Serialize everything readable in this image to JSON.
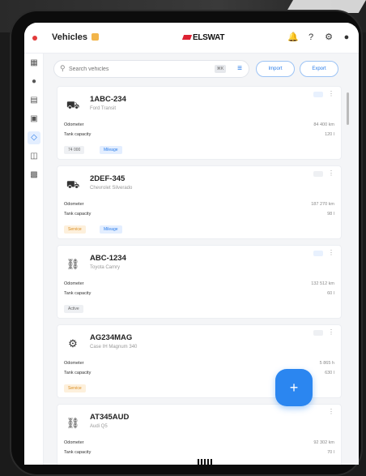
{
  "app": {
    "title": "Vehicles",
    "logo": "ELSWAT"
  },
  "header_icons": [
    "bell-icon",
    "help-icon",
    "settings-icon",
    "account-icon"
  ],
  "sidebar": {
    "items": [
      {
        "icon": "dashboard-icon",
        "active": false
      },
      {
        "icon": "user-icon",
        "active": false
      },
      {
        "icon": "document-icon",
        "active": false
      },
      {
        "icon": "calendar-icon",
        "active": false
      },
      {
        "icon": "car-icon",
        "active": true
      },
      {
        "icon": "book-icon",
        "active": false
      },
      {
        "icon": "chart-icon",
        "active": false
      }
    ]
  },
  "search": {
    "placeholder": "Search vehicles",
    "shortcut": "⌘K"
  },
  "actions": {
    "import_label": "Import",
    "export_label": "Export"
  },
  "vehicles": [
    {
      "name": "1ABC-234",
      "subtitle": "Ford Transit",
      "odometer_label": "Odometer",
      "odometer": "84 400 km",
      "tank_label": "Tank capacity",
      "tank": "120 l",
      "icon": "truck-icon",
      "chips": [
        {
          "text": "74 000",
          "tone": "grey"
        },
        {
          "text": "Mileage",
          "tone": "blue"
        }
      ]
    },
    {
      "name": "2DEF-345",
      "subtitle": "Chevrolet Silverado",
      "odometer_label": "Odometer",
      "odometer": "187 270 km",
      "tank_label": "Tank capacity",
      "tank": "98 l",
      "icon": "truck-icon",
      "chips": [
        {
          "text": "Service",
          "tone": "orange"
        },
        {
          "text": "Mileage",
          "tone": "blue"
        }
      ]
    },
    {
      "name": "ABC-1234",
      "subtitle": "Toyota Camry",
      "odometer_label": "Odometer",
      "odometer": "132 512 km",
      "tank_label": "Tank capacity",
      "tank": "60 l",
      "icon": "car-icon",
      "chips": [
        {
          "text": "Active",
          "tone": "grey"
        }
      ]
    },
    {
      "name": "AG234MAG",
      "subtitle": "Case IH Magnum 340",
      "odometer_label": "Odometer",
      "odometer": "5 865 h",
      "tank_label": "Tank capacity",
      "tank": "630 l",
      "icon": "tractor-icon",
      "chips": [
        {
          "text": "Service",
          "tone": "orange"
        }
      ]
    },
    {
      "name": "AT345AUD",
      "subtitle": "Audi Q5",
      "odometer_label": "Odometer",
      "odometer": "92 302 km",
      "tank_label": "Tank capacity",
      "tank": "70 l",
      "icon": "car-icon",
      "chips": []
    }
  ],
  "fab_label": "+"
}
